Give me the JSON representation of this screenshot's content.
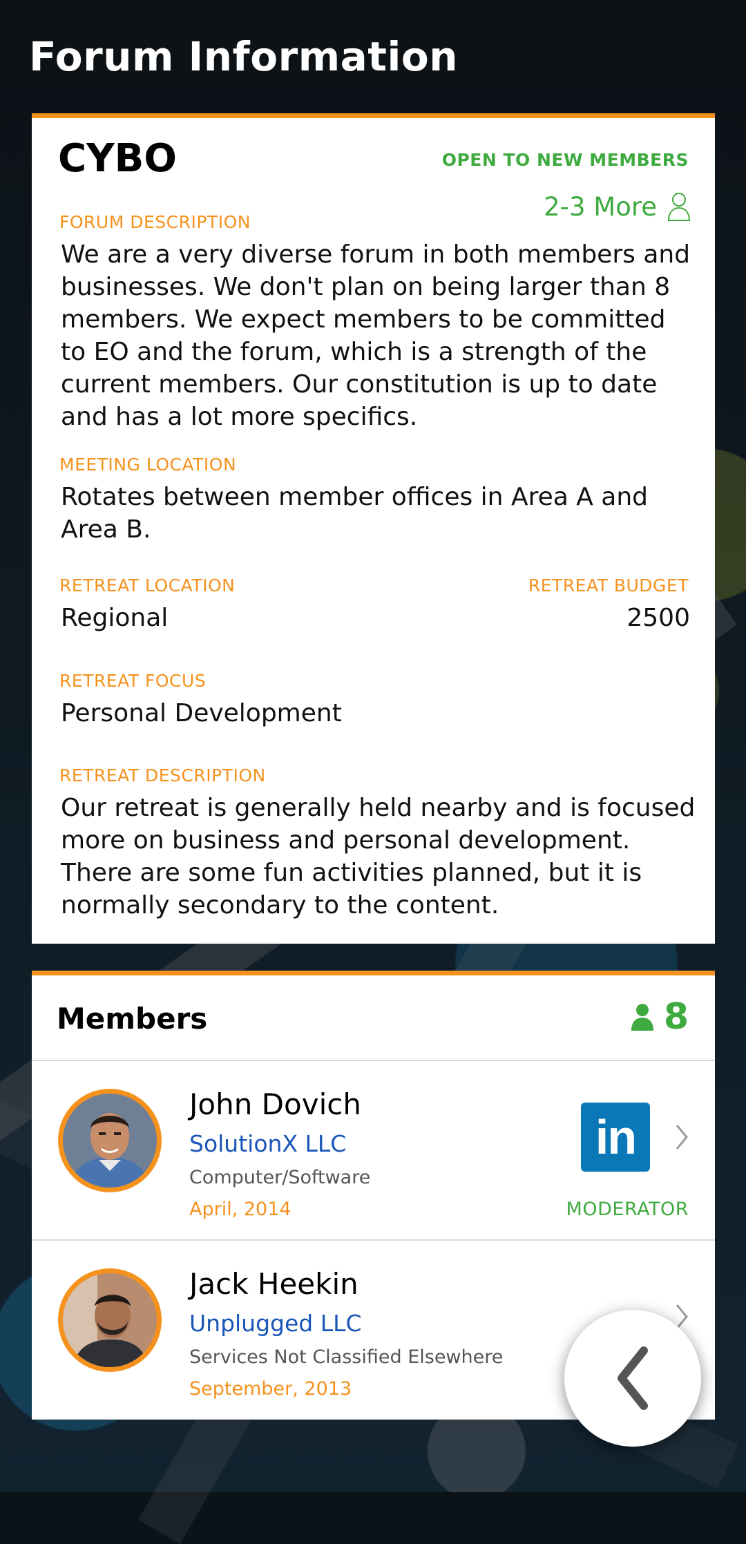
{
  "header": {
    "title": "Forum Information"
  },
  "forum": {
    "name": "CYBO",
    "status": "OPEN TO NEW MEMBERS",
    "openings": "2-3 More",
    "description_label": "FORUM DESCRIPTION",
    "description": "We are a very diverse forum in both members and businesses. We don't plan on being larger than 8 members. We expect members to be committed to EO and the forum, which is a strength of the current members. Our constitution is up to date and has a lot more specifics.",
    "meeting_location_label": "MEETING LOCATION",
    "meeting_location": "Rotates between member offices in Area A and Area B.",
    "retreat_location_label": "RETREAT LOCATION",
    "retreat_location": "Regional",
    "retreat_budget_label": "RETREAT BUDGET",
    "retreat_budget": "2500",
    "retreat_focus_label": "RETREAT FOCUS",
    "retreat_focus": "Personal Development",
    "retreat_description_label": "RETREAT DESCRIPTION",
    "retreat_description": "Our retreat is generally held nearby and is focused more on business and personal development. There are some fun activities planned, but it is normally secondary to the content."
  },
  "members": {
    "title": "Members",
    "count": "8",
    "items": [
      {
        "name": "John Dovich",
        "company": "SolutionX LLC",
        "industry": "Computer/Software",
        "since": "April, 2014",
        "linkedin_label": "in",
        "role": "MODERATOR"
      },
      {
        "name": "Jack Heekin",
        "company": "Unplugged LLC",
        "industry": "Services Not Classified Elsewhere",
        "since": "September, 2013",
        "role": ""
      }
    ]
  },
  "colors": {
    "accent": "#f5921e",
    "success": "#3faa3f",
    "link": "#1a56b8",
    "linkedin": "#0a77b7"
  },
  "icons": [
    "person-outline-icon",
    "person-filled-icon",
    "linkedin-icon",
    "chevron-right-icon",
    "back-arrow-icon"
  ]
}
